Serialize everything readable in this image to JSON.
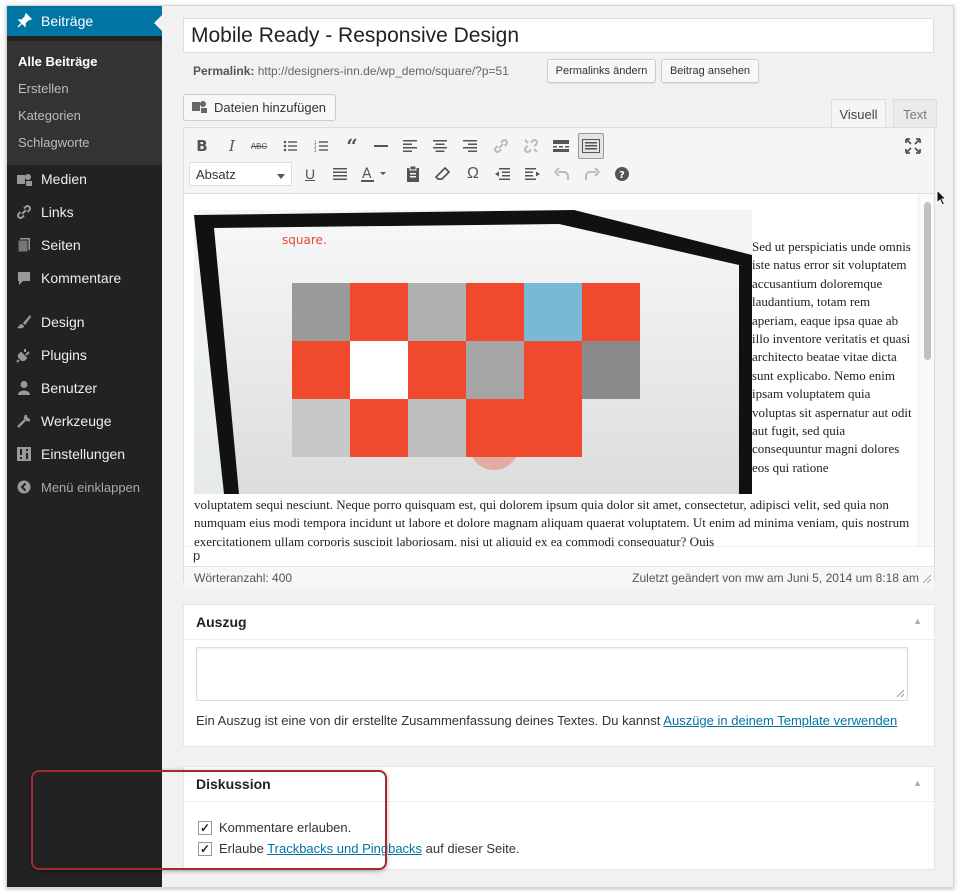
{
  "sidebar": {
    "active": {
      "label": "Beiträge",
      "icon": "pin-icon"
    },
    "submenu": [
      {
        "label": "Alle Beiträge",
        "current": true
      },
      {
        "label": "Erstellen"
      },
      {
        "label": "Kategorien"
      },
      {
        "label": "Schlagworte"
      }
    ],
    "items": [
      {
        "label": "Medien",
        "icon": "media-icon"
      },
      {
        "label": "Links",
        "icon": "link-icon"
      },
      {
        "label": "Seiten",
        "icon": "pages-icon"
      },
      {
        "label": "Kommentare",
        "icon": "comment-icon"
      },
      {
        "label": "Design",
        "icon": "brush-icon"
      },
      {
        "label": "Plugins",
        "icon": "plug-icon"
      },
      {
        "label": "Benutzer",
        "icon": "user-icon"
      },
      {
        "label": "Werkzeuge",
        "icon": "wrench-icon"
      },
      {
        "label": "Einstellungen",
        "icon": "settings-icon"
      }
    ],
    "collapse_label": "Menü einklappen"
  },
  "post": {
    "title": "Mobile Ready - Responsive Design",
    "permalink_label": "Permalink:",
    "permalink_url": "http://designers-inn.de/wp_demo/square/?p=51",
    "change_permalink_button": "Permalinks ändern",
    "view_post_button": "Beitrag ansehen"
  },
  "editor": {
    "add_media_label": "Dateien hinzufügen",
    "tab_visual": "Visuell",
    "tab_text": "Text",
    "format_select": "Absatz",
    "float_text": "Sed ut perspiciatis unde omnis iste natus error sit voluptatem accusantium doloremque laudantium, totam rem aperiam, eaque ipsa quae ab illo inventore veritatis et quasi architecto beatae vitae dicta sunt explicabo. Nemo enim ipsam voluptatem quia voluptas sit aspernatur aut odit aut fugit, sed quia consequuntur magni dolores eos qui ratione",
    "bottom_text": "voluptatem sequi nesciunt. Neque porro quisquam est, qui dolorem ipsum quia dolor sit amet, consectetur, adipisci velit, sed quia non numquam eius modi tempora incidunt ut labore et dolore magnam aliquam quaerat voluptatem. Ut enim ad minima veniam, quis nostrum exercitationem ullam corporis suscipit laboriosam, nisi ut aliquid ex ea commodi consequatur? Quis",
    "path": "p",
    "word_count": "Wörteranzahl: 400",
    "last_edited": "Zuletzt geändert von mw am Juni 5, 2014 um 8:18 am",
    "image_brand": "square."
  },
  "excerpt": {
    "title": "Auszug",
    "description": "Ein Auszug ist eine von dir erstellte Zusammenfassung deines Textes. Du kannst ",
    "link_text": "Auszüge in deinem Template verwenden"
  },
  "discussion": {
    "title": "Diskussion",
    "allow_comments": "Kommentare erlauben.",
    "trackbacks_prefix": "Erlaube ",
    "trackbacks_link": "Trackbacks und Pingbacks",
    "trackbacks_suffix": " auf dieser Seite."
  },
  "colors": {
    "accent": "#0074a2",
    "sidebar": "#222222",
    "highlight_border": "#a12a35",
    "tile_red": "#f04b2f"
  }
}
